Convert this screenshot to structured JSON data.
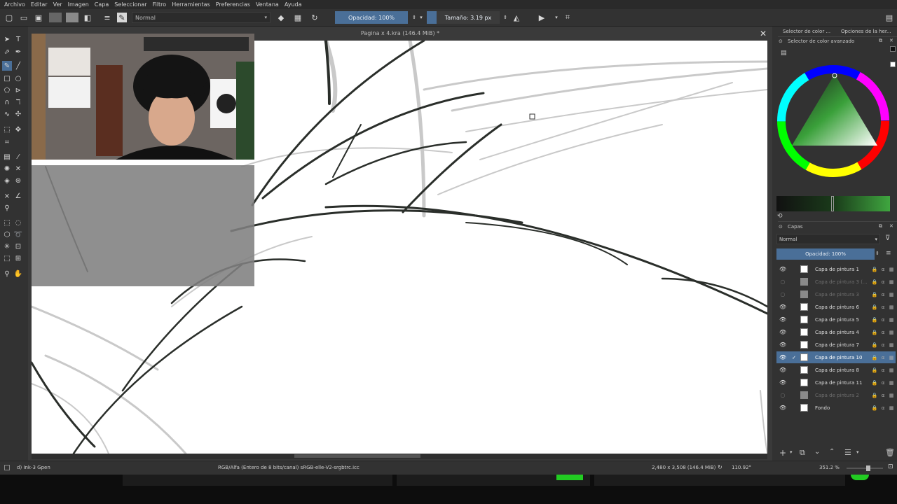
{
  "menu": [
    "Archivo",
    "Editar",
    "Ver",
    "Imagen",
    "Capa",
    "Seleccionar",
    "Filtro",
    "Herramientas",
    "Preferencias",
    "Ventana",
    "Ayuda"
  ],
  "toolbar": {
    "blend_mode": "Normal",
    "opacity_label": "Opacidad: 100%",
    "size_label": "Tamaño: 3.19 px"
  },
  "document": {
    "title": "Pagina x 4.kra (146.4 MiB) *"
  },
  "dock": {
    "tab_color": "Selector de color ...",
    "tab_options": "Opciones de la her...",
    "color_panel_title": "Selector de color avanzado",
    "layers_title": "Capas",
    "layers_blend": "Normal",
    "layers_opacity": "Opacidad:  100%"
  },
  "layers": [
    {
      "name": "Capa de pintura 1",
      "visible": true,
      "selected": false,
      "dim": false
    },
    {
      "name": "Capa de pintura 3 (...",
      "visible": false,
      "selected": false,
      "dim": true
    },
    {
      "name": "Capa de pintura 3",
      "visible": false,
      "selected": false,
      "dim": true
    },
    {
      "name": "Capa de pintura 6",
      "visible": true,
      "selected": false,
      "dim": false
    },
    {
      "name": "Capa de pintura 5",
      "visible": true,
      "selected": false,
      "dim": false
    },
    {
      "name": "Capa de pintura 4",
      "visible": true,
      "selected": false,
      "dim": false
    },
    {
      "name": "Capa de pintura 7",
      "visible": true,
      "selected": false,
      "dim": false
    },
    {
      "name": "Capa de pintura 10",
      "visible": true,
      "selected": true,
      "dim": false
    },
    {
      "name": "Capa de pintura 8",
      "visible": true,
      "selected": false,
      "dim": false
    },
    {
      "name": "Capa de pintura 11",
      "visible": true,
      "selected": false,
      "dim": false
    },
    {
      "name": "Capa de pintura 2",
      "visible": false,
      "selected": false,
      "dim": true
    },
    {
      "name": "Fondo",
      "visible": true,
      "selected": false,
      "dim": false
    }
  ],
  "status": {
    "brush": "d) Ink-3 Gpen",
    "color_space": "RGB/Alfa (Entero de 8 bits/canal)  sRGB-elle-V2-srgbtrc.icc",
    "image_size": "2,480 x 3,508 (146.4 MiB)",
    "rotation": "110.92°",
    "zoom": "351.2 %"
  },
  "colors": {
    "accent": "#4a6f98",
    "panel": "#323232",
    "canvas": "#ffffff"
  }
}
